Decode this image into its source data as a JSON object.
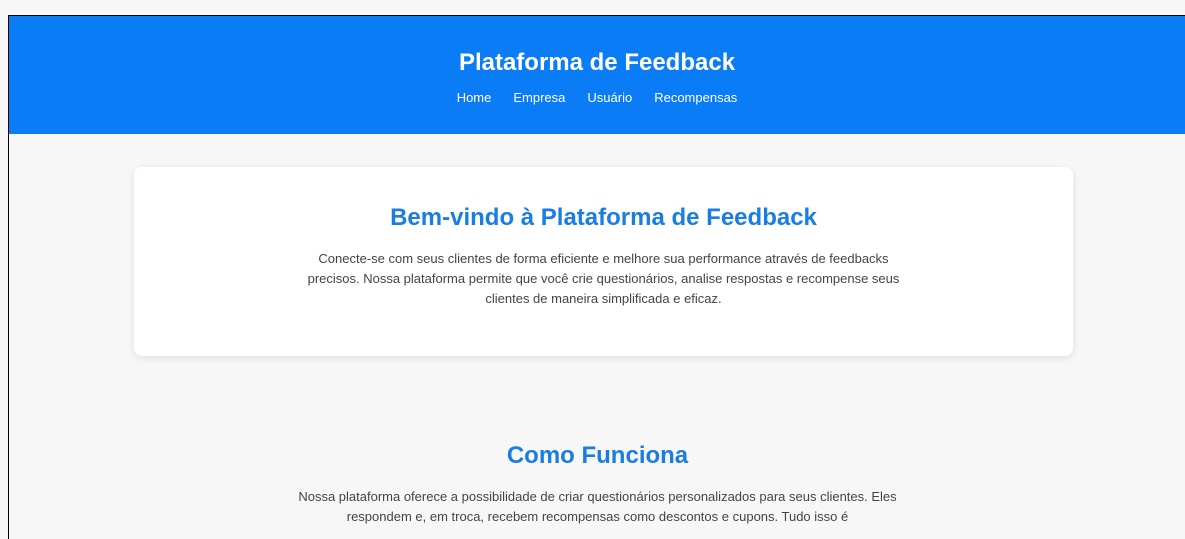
{
  "header": {
    "title": "Plataforma de Feedback",
    "nav": [
      {
        "label": "Home"
      },
      {
        "label": "Empresa"
      },
      {
        "label": "Usuário"
      },
      {
        "label": "Recompensas"
      }
    ]
  },
  "welcome": {
    "title": "Bem-vindo à Plataforma de Feedback",
    "text": "Conecte-se com seus clientes de forma eficiente e melhore sua performance através de feedbacks precisos. Nossa plataforma permite que você crie questionários, analise respostas e recompense seus clientes de maneira simplificada e eficaz."
  },
  "how_it_works": {
    "title": "Como Funciona",
    "text": "Nossa plataforma oferece a possibilidade de criar questionários personalizados para seus clientes. Eles respondem e, em troca, recebem recompensas como descontos e cupons. Tudo isso é"
  },
  "colors": {
    "header_bg": "#0a7cf5",
    "accent_heading": "#1a7de0",
    "page_bg": "#f7f7f7",
    "card_bg": "#ffffff"
  }
}
